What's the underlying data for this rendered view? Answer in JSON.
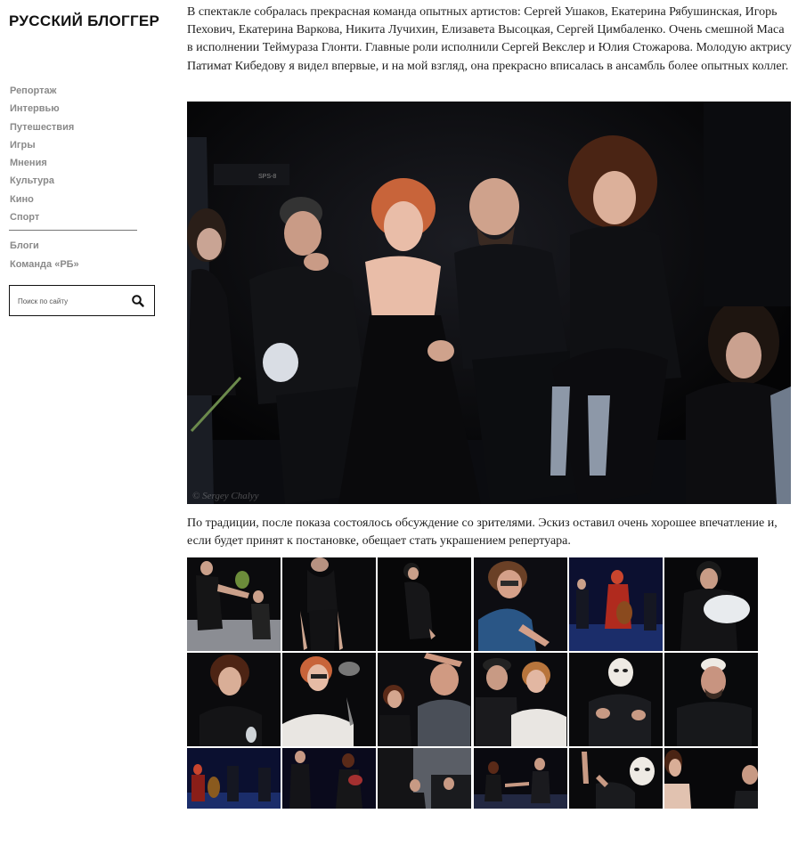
{
  "site": {
    "logo": "РУССКИЙ БЛОГГЕР"
  },
  "nav": {
    "items": [
      "Репортаж",
      "Интервью",
      "Путешествия",
      "Игры",
      "Мнения",
      "Культура",
      "Кино",
      "Спорт"
    ],
    "secondary": [
      "Блоги",
      "Команда «РБ»"
    ]
  },
  "search": {
    "placeholder": "Поиск по сайту",
    "icon": "search-icon"
  },
  "article": {
    "paragraph1": "В спектакле собралась прекрасная команда опытных артистов: Сергей Ушаков, Екатерина Рябушинская, Игорь Пехович, Екатерина Варкова, Никита Лучихин, Елизавета Высоцкая, Сергей Цимбаленко. Очень смешной Маса в исполнении Теймураза Глонти. Главные роли исполнили Сергей Векслер и Юлия Стожарова. Молодую актрису Патимат Кибедову я видел впервые, и на мой взгляд, она прекрасно вписалась в ансамбль более опытных коллег.",
    "paragraph2": "По традиции, после показа состоялось обсуждение со зрителями. Эскиз оставил очень хорошее впечатление и, если будет принят к постановке, обещает стать украшением репертуара.",
    "hero_watermark": "© Sergey Chalyy",
    "hero_equipment_label": "SPS-8"
  },
  "colors": {
    "nav_text": "#8a8a8a",
    "text": "#222222",
    "photo_bg": "#050506"
  }
}
